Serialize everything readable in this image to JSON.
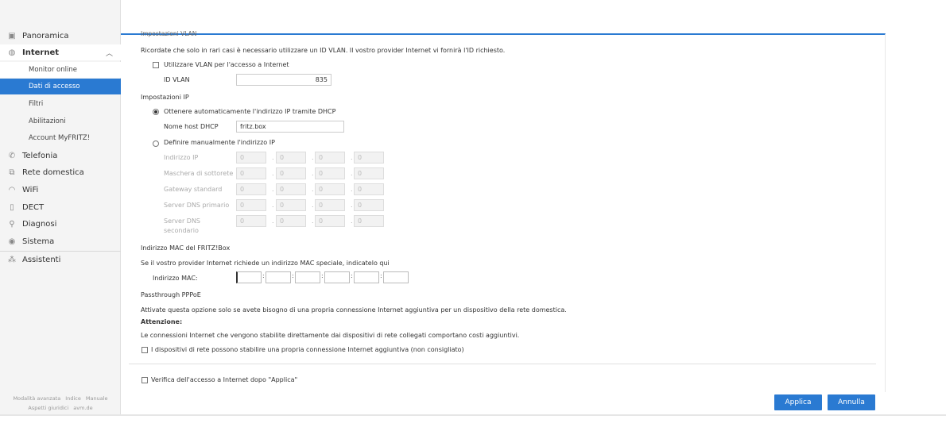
{
  "sidebar": {
    "items": [
      {
        "label": "Panoramica",
        "icon": "overview-icon"
      },
      {
        "label": "Internet",
        "icon": "globe-icon"
      },
      {
        "label": "Monitor online"
      },
      {
        "label": "Dati di accesso"
      },
      {
        "label": "Filtri"
      },
      {
        "label": "Abilitazioni"
      },
      {
        "label": "Account MyFRITZ!"
      },
      {
        "label": "Telefonia",
        "icon": "phone-icon"
      },
      {
        "label": "Rete domestica",
        "icon": "network-icon"
      },
      {
        "label": "WiFi",
        "icon": "wifi-icon"
      },
      {
        "label": "DECT",
        "icon": "dect-icon"
      },
      {
        "label": "Diagnosi",
        "icon": "diagnosis-icon"
      },
      {
        "label": "Sistema",
        "icon": "system-icon"
      },
      {
        "label": "Assistenti",
        "icon": "wizard-icon"
      }
    ],
    "footer": {
      "advanced": "Modalità avanzata",
      "index": "Indice",
      "manual": "Manuale",
      "legal": "Aspetti giuridici",
      "site": "avm.de"
    }
  },
  "vlan": {
    "heading": "Impostazioni VLAN",
    "note": "Ricordate che solo in rari casi è necessario utilizzare un ID VLAN. Il vostro provider Internet vi fornirà l'ID richiesto.",
    "checkbox_label": "Utilizzare VLAN per l'accesso a Internet",
    "id_label": "ID VLAN",
    "id_value": "835"
  },
  "ip": {
    "heading": "Impostazioni IP",
    "auto_label": "Ottenere automaticamente l'indirizzo IP tramite DHCP",
    "host_label": "Nome host DHCP",
    "host_value": "fritz.box",
    "manual_label": "Definire manualmente l'indirizzo IP",
    "rows": [
      {
        "label": "Indirizzo IP",
        "octets": [
          "0",
          "0",
          "0",
          "0"
        ]
      },
      {
        "label": "Maschera di sottorete",
        "octets": [
          "0",
          "0",
          "0",
          "0"
        ]
      },
      {
        "label": "Gateway standard",
        "octets": [
          "0",
          "0",
          "0",
          "0"
        ]
      },
      {
        "label": "Server DNS primario",
        "octets": [
          "0",
          "0",
          "0",
          "0"
        ]
      },
      {
        "label": "Server DNS",
        "label2": "secondario",
        "octets": [
          "0",
          "0",
          "0",
          "0"
        ]
      }
    ]
  },
  "mac": {
    "heading": "Indirizzo MAC del FRITZ!Box",
    "note": "Se il vostro provider Internet richiede un indirizzo MAC speciale, indicatelo qui",
    "label": "Indirizzo MAC:"
  },
  "pppoe": {
    "heading": "Passthrough PPPoE",
    "note": "Attivate questa opzione solo se avete bisogno di una propria connessione Internet aggiuntiva per un dispositivo della rete domestica.",
    "warning_title": "Attenzione:",
    "warning_text": "Le connessioni Internet che vengono stabilite direttamente dai dispositivi di rete collegati comportano costi aggiuntivi.",
    "checkbox_label": "I dispositivi di rete possono stabilire una propria connessione Internet aggiuntiva (non consigliato)"
  },
  "verify": {
    "checkbox_label": "Verifica dell'accesso a Internet dopo \"Applica\""
  },
  "buttons": {
    "apply": "Applica",
    "cancel": "Annulla"
  },
  "colors": {
    "accent": "#2a7ad2"
  }
}
